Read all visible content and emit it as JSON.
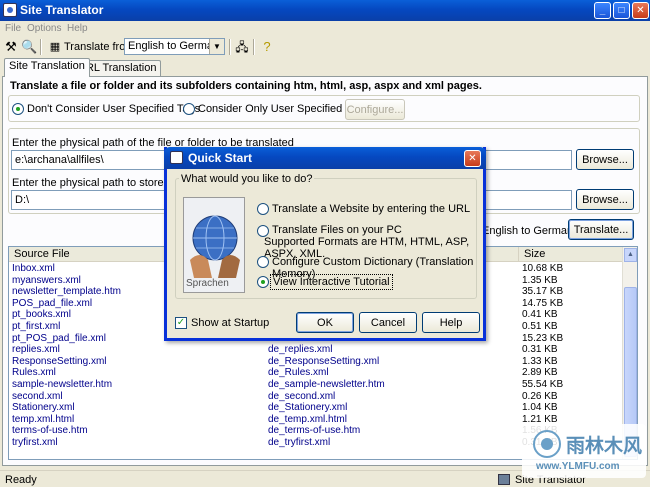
{
  "window": {
    "title": "Site Translator"
  },
  "menu": [
    "File",
    "Options",
    "Help"
  ],
  "toolbar": {
    "translate_from_label": "Translate from",
    "language_pair": "English to German"
  },
  "tabs": [
    "Site Translation",
    "URL Translation"
  ],
  "site": {
    "heading": "Translate a file or folder and its subfolders containing htm, html, asp, aspx and xml pages.",
    "radio_dont": "Don't Consider User Specified Tags",
    "radio_only": "Consider Only  User Specified Tags",
    "configure_btn": "Configure...",
    "source_label": "Enter the physical path of the file or folder to be translated",
    "source_path": "e:\\archana\\allfiles\\",
    "browse_btn": "Browse...",
    "target_label": "Enter the physical path to store the translated",
    "target_path": "D:\\",
    "lang_display": "English to German",
    "translate_btn": "Translate..."
  },
  "list": {
    "columns": [
      "Source File",
      "",
      "Size"
    ],
    "rows": [
      {
        "src": "Inbox.xml",
        "dst": "",
        "size": "10.68 KB"
      },
      {
        "src": "myanswers.xml",
        "dst": "",
        "size": "1.35 KB"
      },
      {
        "src": "newsletter_template.htm",
        "dst": "",
        "size": "35.17 KB"
      },
      {
        "src": "POS_pad_file.xml",
        "dst": "",
        "size": "14.75 KB"
      },
      {
        "src": "pt_books.xml",
        "dst": "",
        "size": "0.41 KB"
      },
      {
        "src": "pt_first.xml",
        "dst": "",
        "size": "0.51 KB"
      },
      {
        "src": "pt_POS_pad_file.xml",
        "dst": "",
        "size": "15.23 KB"
      },
      {
        "src": "replies.xml",
        "dst": "de_replies.xml",
        "size": "0.31 KB"
      },
      {
        "src": "ResponseSetting.xml",
        "dst": "de_ResponseSetting.xml",
        "size": "1.33 KB"
      },
      {
        "src": "Rules.xml",
        "dst": "de_Rules.xml",
        "size": "2.89 KB"
      },
      {
        "src": "sample-newsletter.htm",
        "dst": "de_sample-newsletter.htm",
        "size": "55.54 KB"
      },
      {
        "src": "second.xml",
        "dst": "de_second.xml",
        "size": "0.26 KB"
      },
      {
        "src": "Stationery.xml",
        "dst": "de_Stationery.xml",
        "size": "1.04 KB"
      },
      {
        "src": "temp.xml.html",
        "dst": "de_temp.xml.html",
        "size": "1.21 KB"
      },
      {
        "src": "terms-of-use.htm",
        "dst": "de_terms-of-use.htm",
        "size": "1.56 KB"
      },
      {
        "src": "tryfirst.xml",
        "dst": "de_tryfirst.xml",
        "size": "0.31 KB"
      }
    ]
  },
  "status": {
    "text": "Ready",
    "right": "Site Translator"
  },
  "dialog": {
    "title": "Quick Start",
    "group": "What would you like to do?",
    "image_caption": "Sprachen",
    "opt1": "Translate a Website by entering the URL",
    "opt2": "Translate Files on your PC",
    "opt2_sub": "Supported Formats are HTM, HTML, ASP, ASPX, XML.",
    "opt3": "Configure Custom Dictionary (Translation Memory)",
    "opt4": "View Interactive Tutorial",
    "show_startup": "Show at Startup",
    "ok": "OK",
    "cancel": "Cancel",
    "help": "Help"
  },
  "watermark": {
    "name": "雨林木风",
    "url": "www.YLMFU.com"
  }
}
